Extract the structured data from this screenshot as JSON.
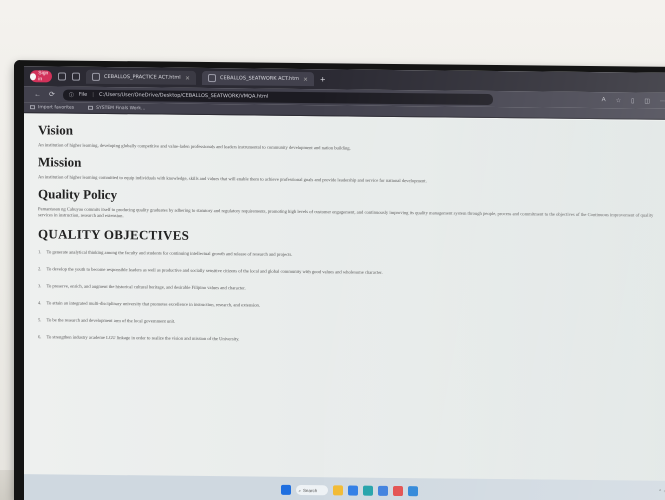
{
  "browser": {
    "profile_label": "Sign in",
    "tabs": [
      {
        "label": "CEBALLOS_PRACTICE ACT.html"
      },
      {
        "label": "CEBALLOS_SEATWORK ACT.htm"
      }
    ],
    "new_tab": "+",
    "url_scheme": "File",
    "url_path": "C:/Users/User/OneDrive/Desktop/CEBALLOS_SEATWORK/VMQA.html",
    "bookmarks": [
      {
        "label": "Import favorites"
      },
      {
        "label": "SYSTEM Finals Work..."
      }
    ]
  },
  "page": {
    "vision": {
      "heading": "Vision",
      "text": "An institution of higher learning, developing globally competitive and value-laden professionals and leaders instrumental to community development and nation building."
    },
    "mission": {
      "heading": "Mission",
      "text": "An institution of higher learning committed to equip individuals with knowledge, skills and values that will enable them to achieve professional goals and provide leadership and service for national development."
    },
    "quality_policy": {
      "heading": "Quality Policy",
      "text": "Pamantasan ng Cabuyao commits itself to producing quality graduates by adhering to statutory and regulatory requirements, promoting high levels of customer engagement, and continuously improving its quality management system through people, process and commitment to the objectives of the Continuous improvement of quality services in instruction, research and extension."
    },
    "objectives": {
      "heading": "QUALITY OBJECTIVES",
      "items": [
        {
          "num": "1.",
          "text": "To generate analytical thinking among the faculty and students for continuing intellectual growth and release of research and projects."
        },
        {
          "num": "2.",
          "text": "To develop the youth to become responsible leaders as well as productive and socially sensitive citizens of the local and global community with good values and wholesome character."
        },
        {
          "num": "3.",
          "text": "To preserve, enrich, and augment the historical cultural heritage, and desirable Filipino values and character."
        },
        {
          "num": "4.",
          "text": "To attain an integrated multi-disciplinary university that promotes excellence in instruction, research, and extension."
        },
        {
          "num": "5.",
          "text": "To be the research and development arm of the local government unit."
        },
        {
          "num": "6.",
          "text": "To strengthen industry academe LGU linkage in order to realize the vision and mission of the University."
        }
      ]
    }
  },
  "taskbar": {
    "search_label": "Search",
    "icons": [
      "windows-icon",
      "search-icon",
      "widgets-icon",
      "explorer-icon",
      "edge-icon",
      "store-icon",
      "chrome-icon",
      "vscode-icon"
    ],
    "icon_colors": [
      "#1f6fe0",
      "#f2b92f",
      "#2c7be5",
      "#1fa1a8",
      "#e24b4b",
      "#3b7ddd",
      "#2b84d8"
    ]
  },
  "colors": {
    "chrome_dark": "#2b2a33",
    "chrome_mid": "#42414d",
    "profile_accent": "#d2325a",
    "page_bg": "#eef0ef",
    "taskbar_bg": "#cfd8e0"
  }
}
